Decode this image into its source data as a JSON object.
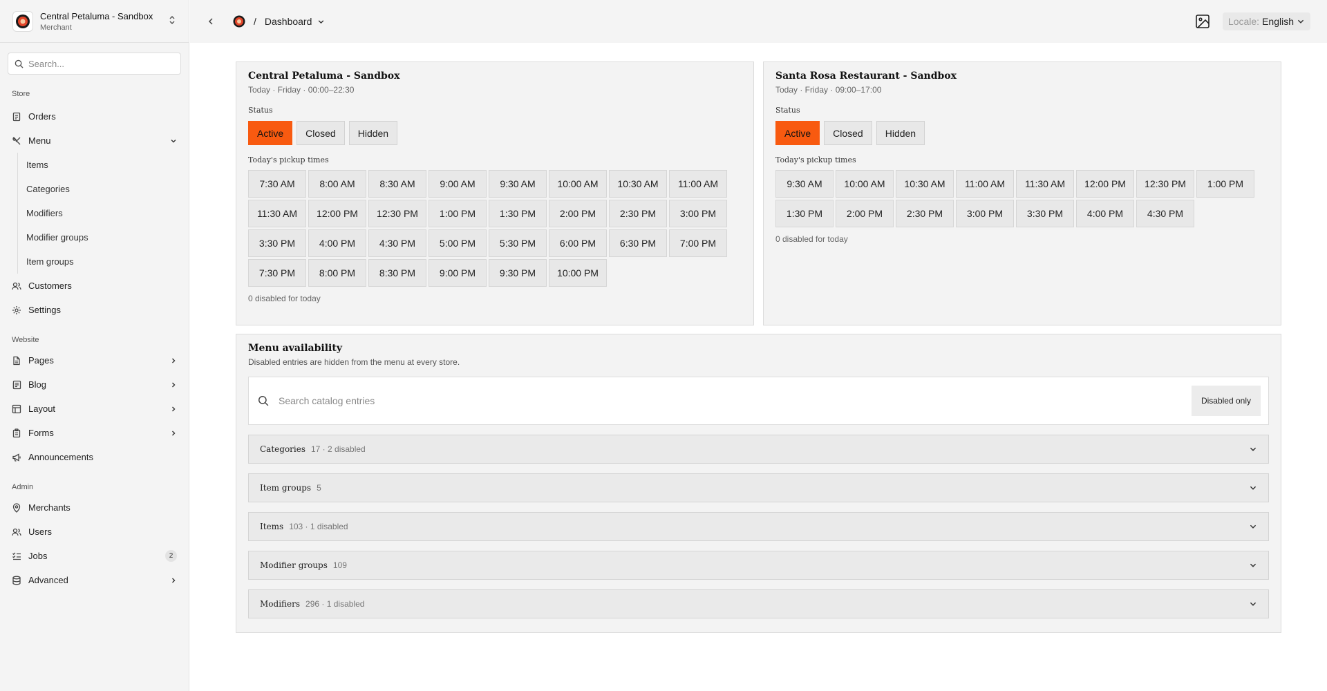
{
  "sidebar": {
    "merchant_name": "Central Petaluma - Sandbox",
    "merchant_role": "Merchant",
    "search_placeholder": "Search...",
    "sections": {
      "store": "Store",
      "website": "Website",
      "admin": "Admin"
    },
    "store_items": {
      "orders": "Orders",
      "menu": "Menu",
      "customers": "Customers",
      "settings": "Settings"
    },
    "menu_subitems": [
      "Items",
      "Categories",
      "Modifiers",
      "Modifier groups",
      "Item groups"
    ],
    "website_items": {
      "pages": "Pages",
      "blog": "Blog",
      "layout": "Layout",
      "forms": "Forms",
      "announcements": "Announcements"
    },
    "admin_items": {
      "merchants": "Merchants",
      "users": "Users",
      "jobs": "Jobs",
      "jobs_badge": "2",
      "advanced": "Advanced"
    }
  },
  "topbar": {
    "separator": "/",
    "breadcrumb": "Dashboard",
    "locale_label": "Locale:",
    "locale_value": "English"
  },
  "stores": [
    {
      "name": "Central Petaluma - Sandbox",
      "hours": "Today · Friday · 00:00–22:30",
      "status_label": "Status",
      "status_options": [
        "Active",
        "Closed",
        "Hidden"
      ],
      "active_status": "Active",
      "pickup_label": "Today's pickup times",
      "times": [
        "7:30 AM",
        "8:00 AM",
        "8:30 AM",
        "9:00 AM",
        "9:30 AM",
        "10:00 AM",
        "10:30 AM",
        "11:00 AM",
        "11:30 AM",
        "12:00 PM",
        "12:30 PM",
        "1:00 PM",
        "1:30 PM",
        "2:00 PM",
        "2:30 PM",
        "3:00 PM",
        "3:30 PM",
        "4:00 PM",
        "4:30 PM",
        "5:00 PM",
        "5:30 PM",
        "6:00 PM",
        "6:30 PM",
        "7:00 PM",
        "7:30 PM",
        "8:00 PM",
        "8:30 PM",
        "9:00 PM",
        "9:30 PM",
        "10:00 PM"
      ],
      "disabled_note": "0 disabled for today"
    },
    {
      "name": "Santa Rosa Restaurant - Sandbox",
      "hours": "Today · Friday · 09:00–17:00",
      "status_label": "Status",
      "status_options": [
        "Active",
        "Closed",
        "Hidden"
      ],
      "active_status": "Active",
      "pickup_label": "Today's pickup times",
      "times": [
        "9:30 AM",
        "10:00 AM",
        "10:30 AM",
        "11:00 AM",
        "11:30 AM",
        "12:00 PM",
        "12:30 PM",
        "1:00 PM",
        "1:30 PM",
        "2:00 PM",
        "2:30 PM",
        "3:00 PM",
        "3:30 PM",
        "4:00 PM",
        "4:30 PM"
      ],
      "disabled_note": "0 disabled for today"
    }
  ],
  "menu_availability": {
    "title": "Menu availability",
    "subtitle": "Disabled entries are hidden from the menu at every store.",
    "search_placeholder": "Search catalog entries",
    "filter_button": "Disabled only",
    "groups": [
      {
        "name": "Categories",
        "meta": "17 · 2 disabled"
      },
      {
        "name": "Item groups",
        "meta": "5"
      },
      {
        "name": "Items",
        "meta": "103 · 1 disabled"
      },
      {
        "name": "Modifier groups",
        "meta": "109"
      },
      {
        "name": "Modifiers",
        "meta": "296 · 1 disabled"
      }
    ]
  },
  "colors": {
    "accent": "#f85a10",
    "sidebar_bg": "#f4f4f4",
    "card_bg": "#f3f3f3"
  }
}
